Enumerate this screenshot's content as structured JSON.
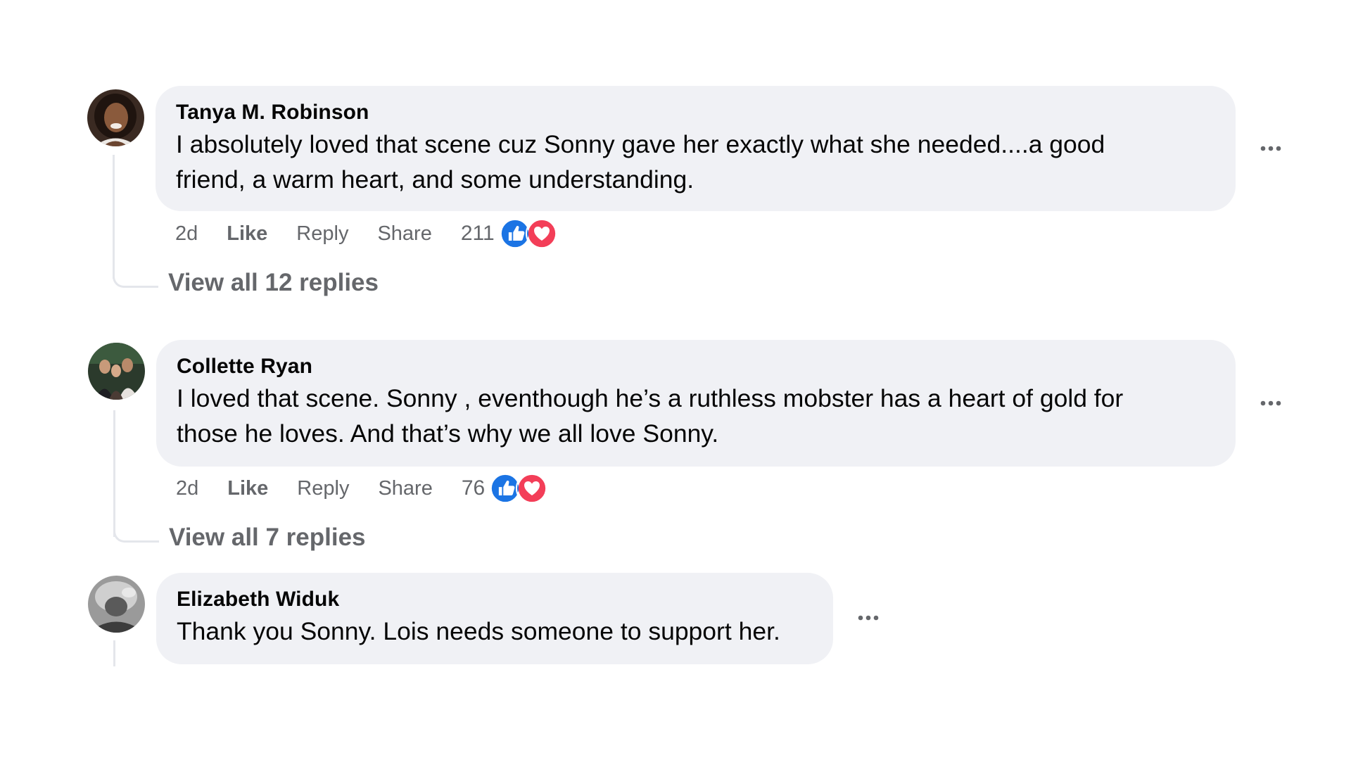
{
  "comments": [
    {
      "author": "Tanya M. Robinson",
      "text_line1": "I absolutely loved that scene cuz Sonny gave her exactly what she needed....a good",
      "text_line2": "friend, a warm heart, and some understanding.",
      "time": "2d",
      "like_label": "Like",
      "reply_label": "Reply",
      "share_label": "Share",
      "reaction_count": "211",
      "reactions": [
        "like-icon",
        "love-icon"
      ],
      "view_replies": "View all 12 replies"
    },
    {
      "author": "Collette Ryan",
      "text_line1": "I loved that scene. Sonny , eventhough he’s a ruthless mobster has a heart of gold for",
      "text_line2": "those he loves. And that’s why we all love Sonny.",
      "time": "2d",
      "like_label": "Like",
      "reply_label": "Reply",
      "share_label": "Share",
      "reaction_count": "76",
      "reactions": [
        "like-icon",
        "love-icon"
      ],
      "view_replies": "View all 7 replies"
    },
    {
      "author": "Elizabeth Widuk",
      "text_line1": "Thank you Sonny. Lois needs someone to support her.",
      "reactions": []
    }
  ],
  "colors": {
    "bubble_bg": "#f0f1f5",
    "meta_text": "#65676b",
    "like_blue": "#1b74e4",
    "love_red": "#f33e58",
    "thread_line": "#e4e6eb"
  }
}
